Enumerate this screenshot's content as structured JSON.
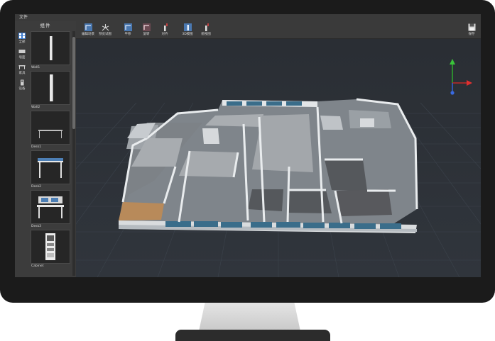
{
  "menubar": {
    "file_label": "文件"
  },
  "sidebar": {
    "title": "组件",
    "categories": [
      {
        "label": "全部",
        "icon": "grid-icon",
        "selected": true
      },
      {
        "label": "墙面",
        "icon": "wall-icon",
        "selected": false
      },
      {
        "label": "家具",
        "icon": "furniture-icon",
        "selected": false
      },
      {
        "label": "设备",
        "icon": "device-icon",
        "selected": false
      }
    ],
    "items": [
      {
        "name": "Wall1"
      },
      {
        "name": "Wall2"
      },
      {
        "name": "Desk1"
      },
      {
        "name": "Desk2"
      },
      {
        "name": "Desk3"
      },
      {
        "name": "Cabinet"
      }
    ]
  },
  "toolbar": {
    "tools": [
      {
        "label": "编辑场景",
        "icon": "edit-scene-icon"
      },
      {
        "label": "预览试图",
        "icon": "preview-icon"
      },
      {
        "label": "平移",
        "icon": "pan-icon"
      },
      {
        "label": "旋转",
        "icon": "rotate-icon"
      },
      {
        "label": "对齐",
        "icon": "align-icon"
      },
      {
        "label": "3D模图",
        "icon": "3d-view-icon"
      },
      {
        "label": "俯视图",
        "icon": "top-view-icon"
      }
    ],
    "save_label": "保存"
  },
  "colors": {
    "accent": "#3b7bd0",
    "viewport_bg": "#2b2e33",
    "grid": "#3d434b"
  }
}
